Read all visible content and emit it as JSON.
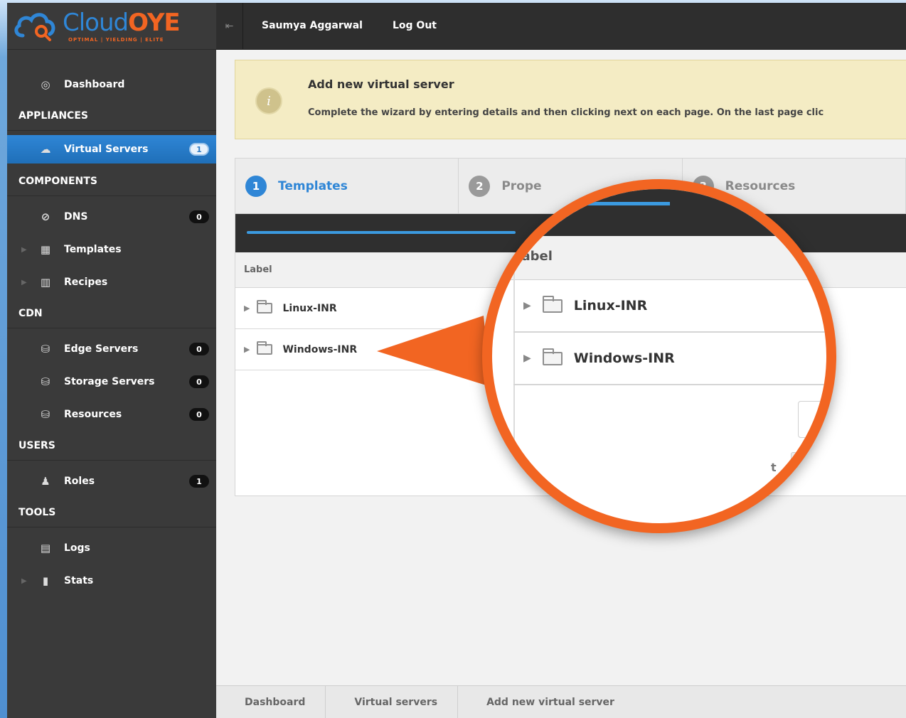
{
  "brand": {
    "name_part1": "Cloud",
    "name_part2": "OYE",
    "tagline": "OPTIMAL | YIELDING | ELITE"
  },
  "header": {
    "user_name": "Saumya Aggarwal",
    "logout_label": "Log Out"
  },
  "sidebar": {
    "dashboard": "Dashboard",
    "sections": {
      "appliances": "APPLIANCES",
      "components": "COMPONENTS",
      "cdn": "CDN",
      "users": "USERS",
      "tools": "TOOLS"
    },
    "items": {
      "virtual_servers": {
        "label": "Virtual Servers",
        "badge": "1"
      },
      "dns": {
        "label": "DNS",
        "badge": "0"
      },
      "templates": {
        "label": "Templates"
      },
      "recipes": {
        "label": "Recipes"
      },
      "edge_servers": {
        "label": "Edge Servers",
        "badge": "0"
      },
      "storage_servers": {
        "label": "Storage Servers",
        "badge": "0"
      },
      "resources": {
        "label": "Resources",
        "badge": "0"
      },
      "roles": {
        "label": "Roles",
        "badge": "1"
      },
      "logs": {
        "label": "Logs"
      },
      "stats": {
        "label": "Stats"
      }
    }
  },
  "info": {
    "title": "Add new virtual server",
    "text": "Complete the wizard by entering details and then clicking next on each page. On the last page clic"
  },
  "wizard": {
    "steps": [
      {
        "num": "1",
        "label": "Templates"
      },
      {
        "num": "2",
        "label": "Prope"
      },
      {
        "num": "3",
        "label": "Resources"
      }
    ],
    "table_header": "Label",
    "rows": [
      "Linux-INR",
      "Windows-INR"
    ]
  },
  "magnifier": {
    "header": "Label",
    "rows": [
      "Linux-INR",
      "Windows-INR"
    ],
    "partial_text": "t",
    "next_icon": "»"
  },
  "breadcrumb": [
    "Dashboard",
    "Virtual servers",
    "Add new virtual server"
  ],
  "colors": {
    "accent": "#2f86d6",
    "brand_orange": "#f26522",
    "sidebar_bg": "#3a3a3a"
  }
}
